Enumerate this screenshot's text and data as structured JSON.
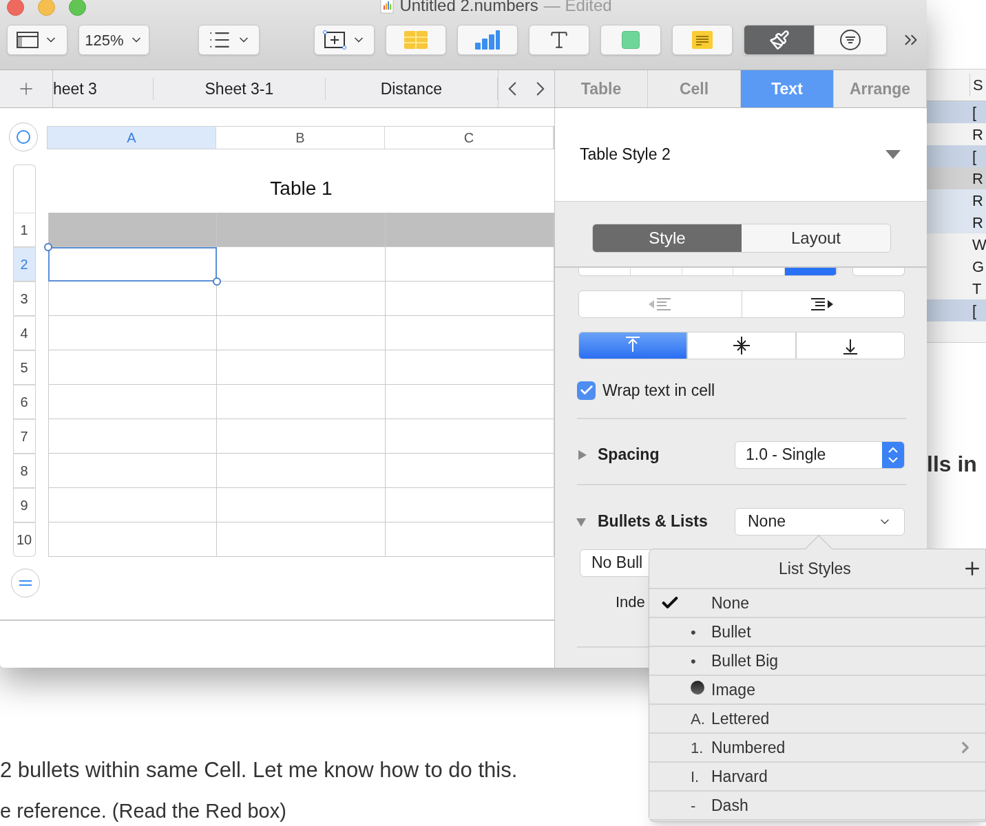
{
  "window": {
    "title": "Untitled 2.numbers",
    "status": "— Edited"
  },
  "toolbar": {
    "zoom": "125%",
    "format_selected": true
  },
  "sheet_tabs": [
    {
      "label": "heet 3"
    },
    {
      "label": "Sheet 3-1"
    },
    {
      "label": "Distance"
    }
  ],
  "inspector_tabs": [
    {
      "label": "Table",
      "selected": false
    },
    {
      "label": "Cell",
      "selected": false
    },
    {
      "label": "Text",
      "selected": true
    },
    {
      "label": "Arrange",
      "selected": false
    }
  ],
  "table": {
    "title": "Table 1",
    "columns": [
      {
        "label": "A",
        "selected": true
      },
      {
        "label": "B",
        "selected": false
      },
      {
        "label": "C",
        "selected": false
      }
    ],
    "rows": [
      {
        "label": "1",
        "kind": "header",
        "selected": false
      },
      {
        "label": "2",
        "kind": "body",
        "selected": true
      },
      {
        "label": "3",
        "kind": "body",
        "selected": false
      },
      {
        "label": "4",
        "kind": "body",
        "selected": false
      },
      {
        "label": "5",
        "kind": "body",
        "selected": false
      },
      {
        "label": "6",
        "kind": "body",
        "selected": false
      },
      {
        "label": "7",
        "kind": "body",
        "selected": false
      },
      {
        "label": "8",
        "kind": "body",
        "selected": false
      },
      {
        "label": "9",
        "kind": "body",
        "selected": false
      },
      {
        "label": "10",
        "kind": "body",
        "selected": false
      }
    ]
  },
  "inspector": {
    "table_style": "Table Style 2",
    "segments": [
      {
        "label": "Style",
        "selected": true
      },
      {
        "label": "Layout",
        "selected": false
      }
    ],
    "horizontal_alignment": [
      {
        "selected": false
      },
      {
        "selected": false
      },
      {
        "selected": false
      },
      {
        "selected": false
      },
      {
        "selected": true
      }
    ],
    "vertical_alignment": [
      {
        "kind": "top",
        "selected": true
      },
      {
        "kind": "middle",
        "selected": false
      },
      {
        "kind": "bottom",
        "selected": false
      }
    ],
    "wrap": {
      "label": "Wrap text in cell",
      "checked": true
    },
    "spacing": {
      "label": "Spacing",
      "expanded": false,
      "value": "1.0 - Single"
    },
    "bullets": {
      "label": "Bullets & Lists",
      "expanded": true,
      "value": "None"
    },
    "bullet_field": "No Bull",
    "indent_label": "Inde"
  },
  "popover": {
    "title": "List Styles",
    "items": [
      {
        "kind": "text",
        "marker": "",
        "label": "None",
        "selected": true,
        "submenu": false
      },
      {
        "kind": "text",
        "marker": "•",
        "label": "Bullet",
        "selected": false,
        "submenu": false
      },
      {
        "kind": "text",
        "marker": "•",
        "label": "Bullet Big",
        "selected": false,
        "submenu": false
      },
      {
        "kind": "image",
        "label": "Image",
        "selected": false,
        "submenu": false
      },
      {
        "kind": "text",
        "marker": "A.",
        "label": "Lettered",
        "selected": false,
        "submenu": false
      },
      {
        "kind": "text",
        "marker": "1.",
        "label": "Numbered",
        "selected": false,
        "submenu": true
      },
      {
        "kind": "text",
        "marker": "I.",
        "label": "Harvard",
        "selected": false,
        "submenu": false
      },
      {
        "kind": "text",
        "marker": "-",
        "label": "Dash",
        "selected": false,
        "submenu": false
      }
    ]
  },
  "background": {
    "strip_header": "S",
    "strip_rows": [
      {
        "text": "[",
        "color": "#c8d4e6"
      },
      {
        "text": "R",
        "color": "#f2f2f2"
      },
      {
        "text": "[",
        "color": "#c8d4e6"
      },
      {
        "text": "R",
        "color": "#d2d2d2"
      },
      {
        "text": "R",
        "color": "#dde5f0"
      },
      {
        "text": "R",
        "color": "#dde5f0"
      },
      {
        "text": "W",
        "color": "#f2f2f2"
      },
      {
        "text": "G",
        "color": "#f2f2f2"
      },
      {
        "text": "T",
        "color": "#f2f2f2"
      },
      {
        "text": "[",
        "color": "#c8d4e6"
      }
    ],
    "heading": "lls in",
    "paragraphs": [
      "2 bullets within same Cell. Let me know how to do this.",
      "e reference. (Read the Red box)"
    ]
  }
}
